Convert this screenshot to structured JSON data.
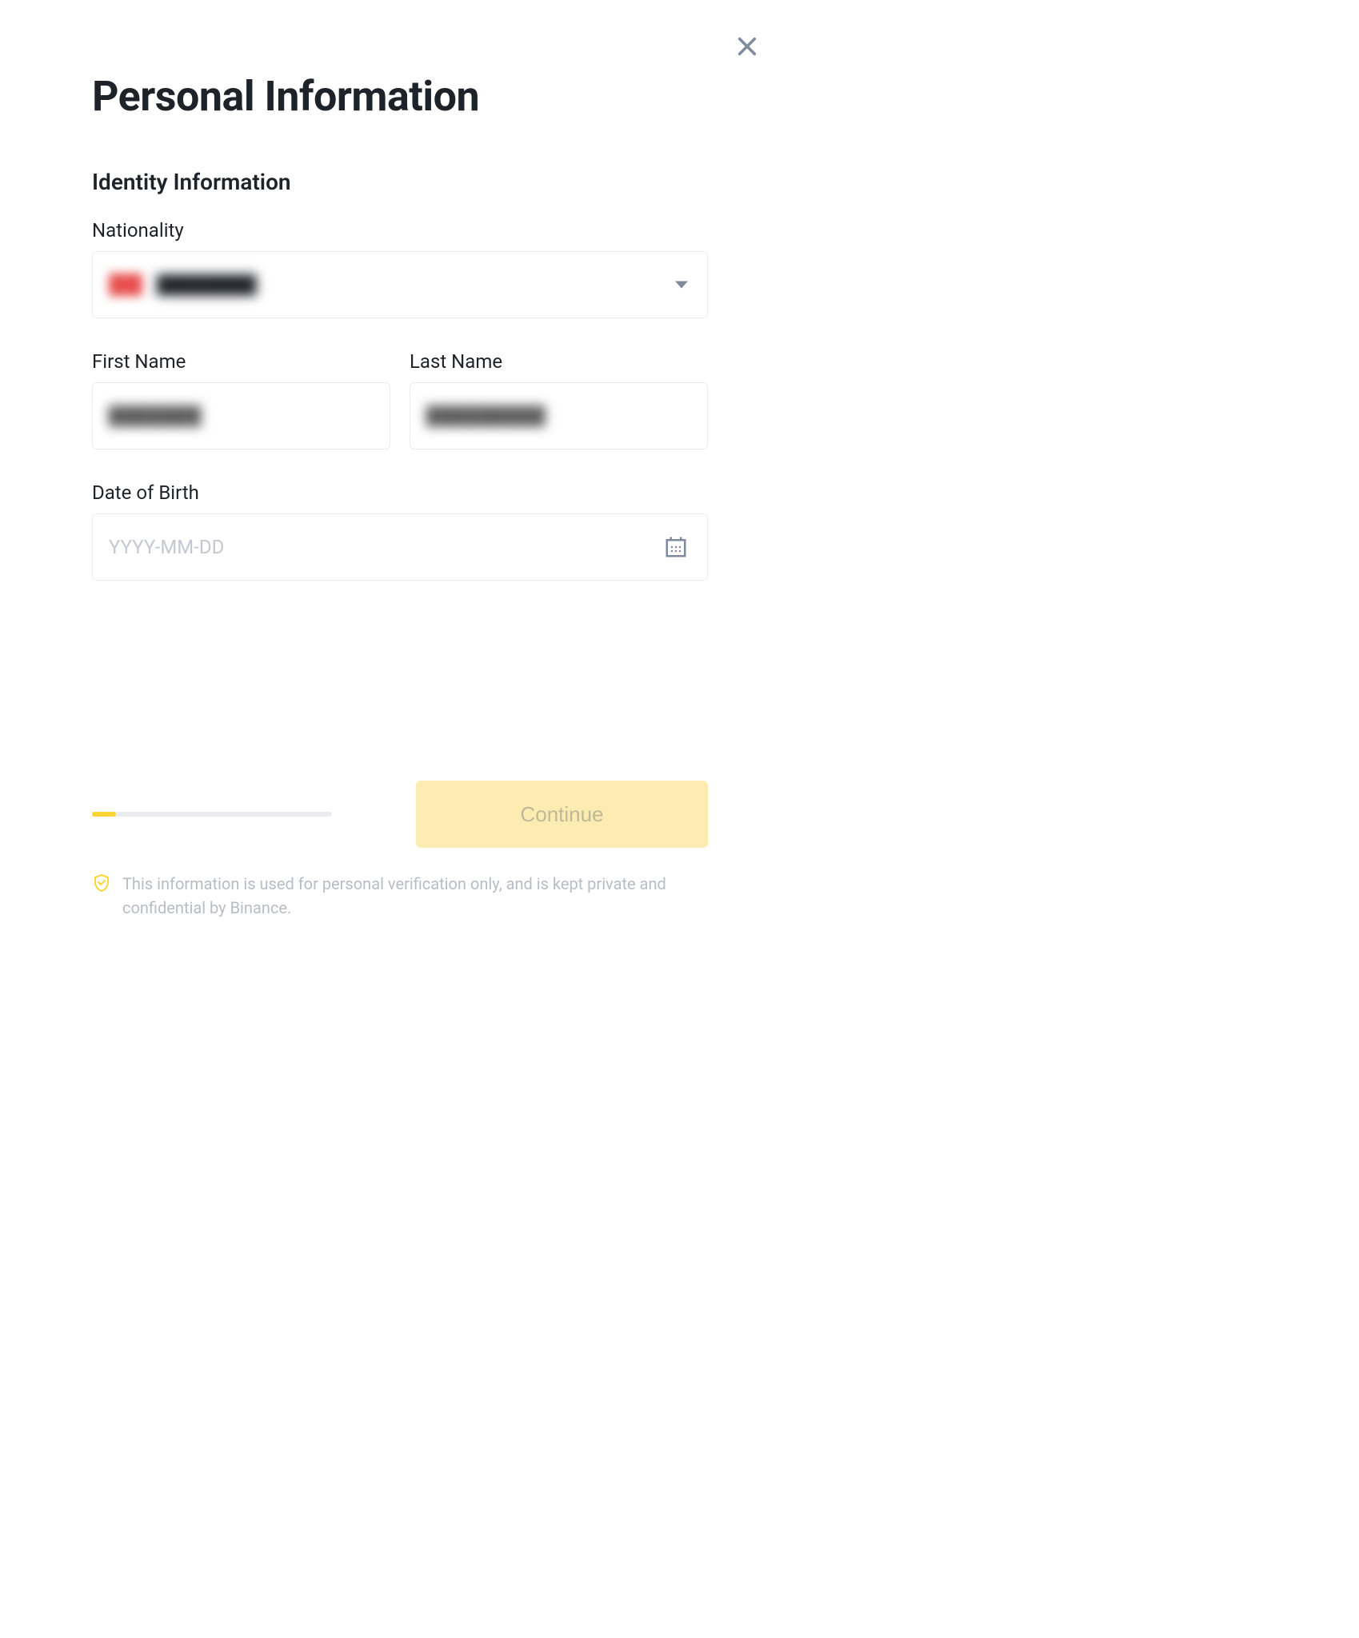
{
  "header": {
    "title": "Personal Information"
  },
  "section": {
    "title": "Identity Information"
  },
  "fields": {
    "nationality": {
      "label": "Nationality",
      "value": "████████"
    },
    "firstName": {
      "label": "First Name",
      "value": "███████"
    },
    "lastName": {
      "label": "Last Name",
      "value": "█████████"
    },
    "dob": {
      "label": "Date of Birth",
      "placeholder": "YYYY-MM-DD",
      "value": ""
    }
  },
  "progress": {
    "percent": 10
  },
  "actions": {
    "continue": "Continue"
  },
  "footer": {
    "note": "This information is used for personal verification only, and is kept private and confidential by Binance."
  }
}
